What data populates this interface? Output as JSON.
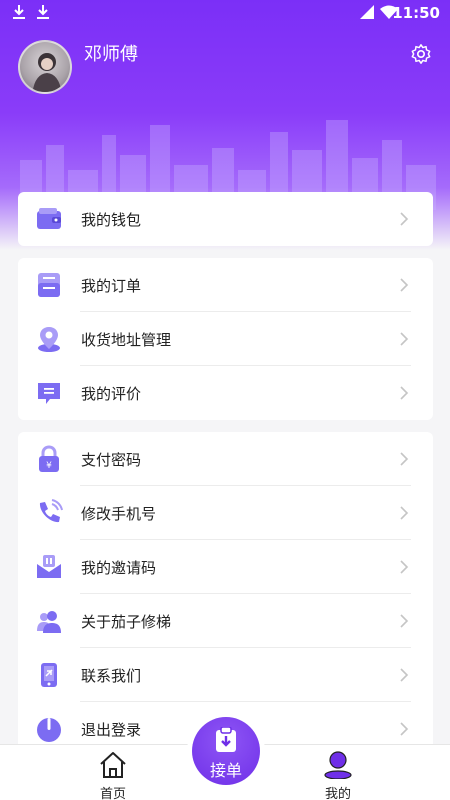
{
  "status_bar": {
    "time": "11:50"
  },
  "profile": {
    "name": "邓师傅"
  },
  "colors": {
    "accent": "#7b2ff7",
    "icon": "#7c6cf2"
  },
  "wallet_card": [
    {
      "label": "我的钱包",
      "icon": "wallet-icon"
    }
  ],
  "orders_card": [
    {
      "label": "我的订单",
      "icon": "order-icon"
    },
    {
      "label": "收货地址管理",
      "icon": "location-icon"
    },
    {
      "label": "我的评价",
      "icon": "comment-icon"
    }
  ],
  "settings_card": [
    {
      "label": "支付密码",
      "icon": "lock-icon"
    },
    {
      "label": "修改手机号",
      "icon": "phone-icon"
    },
    {
      "label": "我的邀请码",
      "icon": "invite-icon"
    },
    {
      "label": "关于茄子修梯",
      "icon": "about-icon"
    },
    {
      "label": "联系我们",
      "icon": "contact-icon"
    },
    {
      "label": "退出登录",
      "icon": "power-icon"
    }
  ],
  "tabbar": {
    "home": "首页",
    "center": "接单",
    "mine": "我的"
  }
}
